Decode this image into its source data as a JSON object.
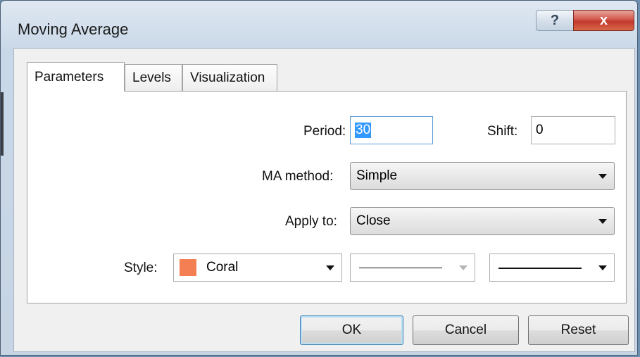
{
  "window": {
    "title": "Moving Average",
    "help_label": "?",
    "close_label": "x"
  },
  "tabs": [
    {
      "label": "Parameters",
      "active": true
    },
    {
      "label": "Levels",
      "active": false
    },
    {
      "label": "Visualization",
      "active": false
    }
  ],
  "params": {
    "period_label": "Period:",
    "period_value": "30",
    "shift_label": "Shift:",
    "shift_value": "0",
    "ma_method_label": "MA method:",
    "ma_method_value": "Simple",
    "apply_to_label": "Apply to:",
    "apply_to_value": "Close",
    "style_label": "Style:",
    "style_color_name": "Coral",
    "style_color_hex": "#f47f52"
  },
  "buttons": {
    "ok": "OK",
    "cancel": "Cancel",
    "reset": "Reset"
  }
}
